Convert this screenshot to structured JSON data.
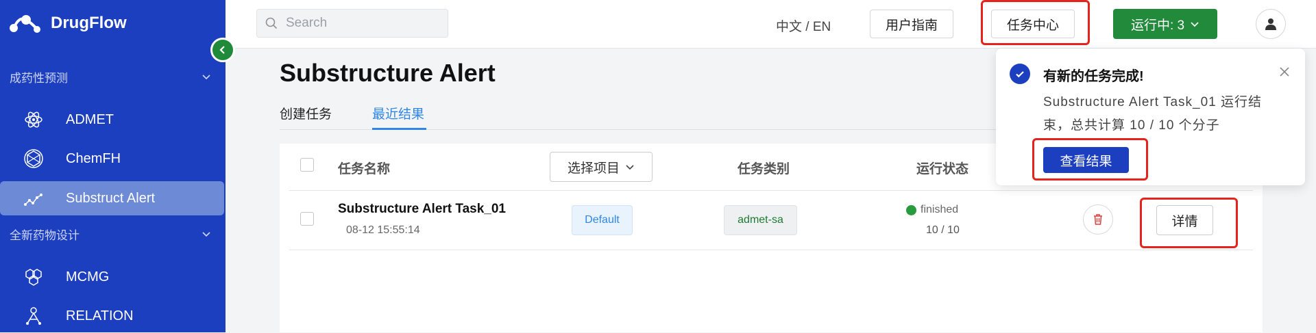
{
  "app": {
    "name": "DrugFlow"
  },
  "sidebar": {
    "sections": [
      {
        "label": "成药性预测"
      },
      {
        "label": "全新药物设计"
      }
    ],
    "items": [
      {
        "label": "ADMET",
        "icon": "atom-icon"
      },
      {
        "label": "ChemFH",
        "icon": "hexagon-icon"
      },
      {
        "label": "Substruct Alert",
        "icon": "molecule-chain-icon",
        "active": true
      },
      {
        "label": "MCMG",
        "icon": "molecule-cluster-icon"
      },
      {
        "label": "RELATION",
        "icon": "relation-icon"
      }
    ]
  },
  "topbar": {
    "search_placeholder": "Search",
    "language": "中文 / EN",
    "guide_label": "用户指南",
    "task_center_label": "任务中心",
    "running_label": "运行中: 3"
  },
  "page": {
    "title": "Substructure Alert",
    "tabs": [
      {
        "label": "创建任务"
      },
      {
        "label": "最近结果",
        "active": true
      }
    ]
  },
  "table": {
    "headers": {
      "name": "任务名称",
      "project": "选择项目",
      "type": "任务类别",
      "status": "运行状态"
    },
    "rows": [
      {
        "name": "Substructure Alert Task_01",
        "time": "08-12 15:55:14",
        "project": "Default",
        "type": "admet-sa",
        "status": "finished",
        "progress": "10 / 10",
        "detail_label": "详情"
      }
    ]
  },
  "notification": {
    "title": "有新的任务完成!",
    "body": "Substructure Alert Task_01 运行结束，总共计算 10 / 10 个分子",
    "button_label": "查看结果"
  },
  "colors": {
    "sidebar_bg": "#1c3fc0",
    "active_item_bg": "#6d8ad6",
    "running_green": "#228b3b",
    "accent_blue": "#2f86e8",
    "highlight_red": "#e5221b"
  }
}
